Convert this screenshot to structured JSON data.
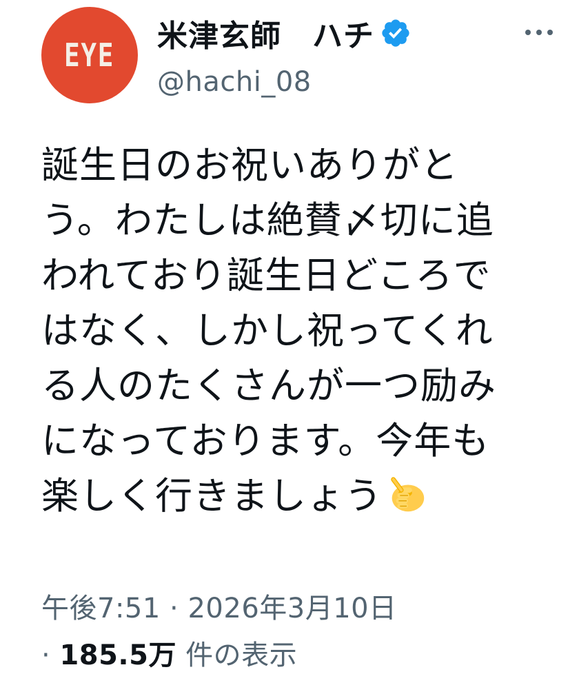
{
  "author": {
    "avatar_text": "EYE",
    "display_name": "米津玄師　ハチ",
    "handle": "@hachi_08",
    "verified": true
  },
  "post": {
    "lines": [
      "誕生日のお祝いありがと",
      "う。わたしは絶賛〆切に追",
      "われており誕生日どころで",
      "はなく、しかし祝ってくれ",
      "る人のたくさんが一つ励み",
      "になっております。今年も",
      "楽しく行きましょう"
    ],
    "trailing_emoji": "pointing-hand-emoji"
  },
  "meta": {
    "time": "午後7:51",
    "separator": " · ",
    "date": "2026年3月10日",
    "views_prefix": "· ",
    "views_count": "185.5万",
    "views_label": " 件の表示"
  },
  "colors": {
    "avatar_bg": "#e2492f",
    "verified_blue": "#1d9bf0",
    "secondary_text": "#536471",
    "primary_text": "#0f1419"
  },
  "icons": {
    "more": "more-horizontal-icon",
    "verified": "verified-badge-icon"
  }
}
